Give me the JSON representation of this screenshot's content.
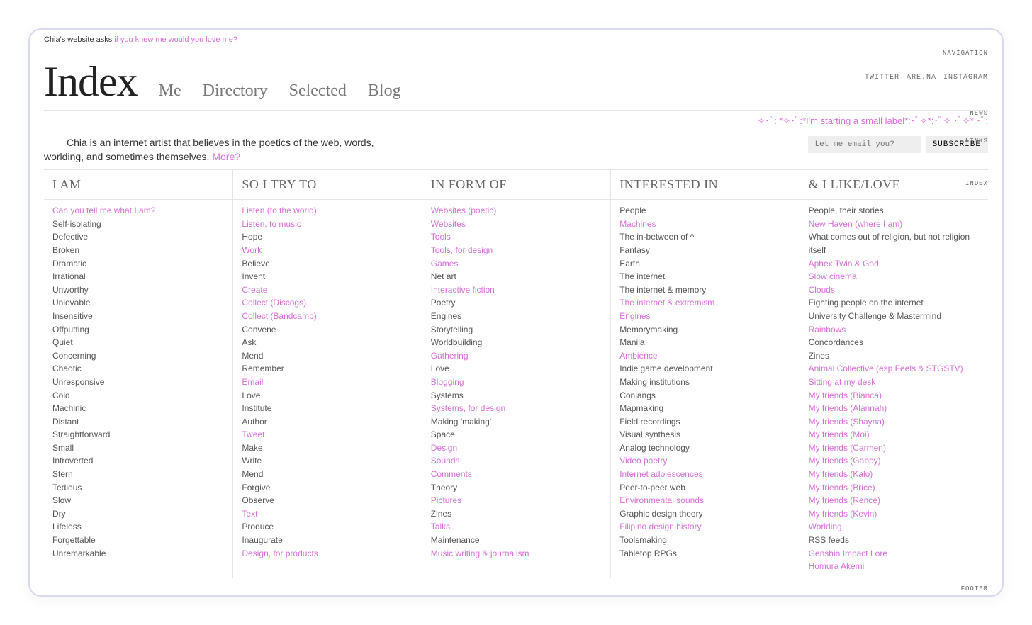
{
  "tagline_prefix": "Chia's website asks ",
  "tagline_question": "if you knew me would you love me?",
  "section_labels": {
    "navigation": "NAVIGATION",
    "news": "NEWS",
    "links": "LINKS",
    "index": "INDEX",
    "footer": "FOOTER"
  },
  "logo": "Index",
  "nav": [
    "Me",
    "Directory",
    "Selected",
    "Blog"
  ],
  "socials": [
    "TWITTER",
    "ARE.NA",
    "INSTAGRAM"
  ],
  "news_line": "✧･ﾟ: *✧･ﾟ:*I'm starting a small label*:･ﾟ✧*:･ﾟ✧ ･ﾟ✧*:･ﾟ:",
  "intro_text": "Chia is an internet artist that believes in the poetics of the web, words, worlding, and sometimes themselves. ",
  "intro_more": "More?",
  "subscribe_placeholder": "Let me email you?",
  "subscribe_button": "SUBSCRIBE",
  "columns": [
    {
      "head": "I AM",
      "items": [
        {
          "t": "Can you tell me what I am?",
          "link": true
        },
        {
          "t": "Self-isolating"
        },
        {
          "t": "Defective"
        },
        {
          "t": "Broken"
        },
        {
          "t": "Dramatic"
        },
        {
          "t": "Irrational"
        },
        {
          "t": "Unworthy"
        },
        {
          "t": "Unlovable"
        },
        {
          "t": "Insensitive"
        },
        {
          "t": "Offputting"
        },
        {
          "t": "Quiet"
        },
        {
          "t": "Concerning"
        },
        {
          "t": "Chaotic"
        },
        {
          "t": "Unresponsive"
        },
        {
          "t": "Cold"
        },
        {
          "t": "Machinic"
        },
        {
          "t": "Distant"
        },
        {
          "t": "Straightforward"
        },
        {
          "t": "Small"
        },
        {
          "t": "Introverted"
        },
        {
          "t": "Stern"
        },
        {
          "t": "Tedious"
        },
        {
          "t": "Slow"
        },
        {
          "t": "Dry"
        },
        {
          "t": "Lifeless"
        },
        {
          "t": "Forgettable"
        },
        {
          "t": "Unremarkable"
        }
      ]
    },
    {
      "head": "SO I TRY TO",
      "items": [
        {
          "t": "Listen (to the world)",
          "link": true
        },
        {
          "t": "Listen, to music",
          "link": true
        },
        {
          "t": "Hope"
        },
        {
          "t": "Work",
          "link": true
        },
        {
          "t": "Believe"
        },
        {
          "t": "Invent"
        },
        {
          "t": "Create",
          "link": true
        },
        {
          "t": "Collect (Discogs)",
          "link": true
        },
        {
          "t": "Collect (Bandcamp)",
          "link": true
        },
        {
          "t": "Convene"
        },
        {
          "t": "Ask"
        },
        {
          "t": "Mend"
        },
        {
          "t": "Remember"
        },
        {
          "t": "Email",
          "link": true
        },
        {
          "t": "Love"
        },
        {
          "t": "Institute"
        },
        {
          "t": "Author"
        },
        {
          "t": "Tweet",
          "link": true
        },
        {
          "t": "Make"
        },
        {
          "t": "Write"
        },
        {
          "t": "Mend"
        },
        {
          "t": "Forgive"
        },
        {
          "t": "Observe"
        },
        {
          "t": "Text",
          "link": true
        },
        {
          "t": "Produce"
        },
        {
          "t": "Inaugurate"
        },
        {
          "t": "Design, for products",
          "link": true
        }
      ]
    },
    {
      "head": "IN FORM OF",
      "items": [
        {
          "t": "Websites (poetic)",
          "link": true
        },
        {
          "t": "Websites",
          "link": true
        },
        {
          "t": "Tools",
          "link": true
        },
        {
          "t": "Tools, for design",
          "link": true
        },
        {
          "t": "Games",
          "link": true
        },
        {
          "t": "Net art"
        },
        {
          "t": "Interactive fiction",
          "link": true
        },
        {
          "t": "Poetry"
        },
        {
          "t": "Engines"
        },
        {
          "t": "Storytelling"
        },
        {
          "t": "Worldbuilding"
        },
        {
          "t": "Gathering",
          "link": true
        },
        {
          "t": "Love"
        },
        {
          "t": "Blogging",
          "link": true
        },
        {
          "t": "Systems"
        },
        {
          "t": "Systems, for design",
          "link": true
        },
        {
          "t": "Making 'making'"
        },
        {
          "t": "Space"
        },
        {
          "t": "Design",
          "link": true
        },
        {
          "t": "Sounds",
          "link": true
        },
        {
          "t": "Comments",
          "link": true
        },
        {
          "t": "Theory"
        },
        {
          "t": "Pictures",
          "link": true
        },
        {
          "t": "Zines"
        },
        {
          "t": "Talks",
          "link": true
        },
        {
          "t": "Maintenance"
        },
        {
          "t": "Music writing & journalism",
          "link": true
        }
      ]
    },
    {
      "head": "INTERESTED IN",
      "items": [
        {
          "t": "People"
        },
        {
          "t": "Machines",
          "link": true
        },
        {
          "t": "The in-between of ^"
        },
        {
          "t": "Fantasy"
        },
        {
          "t": "Earth"
        },
        {
          "t": "The internet"
        },
        {
          "t": "The internet & memory"
        },
        {
          "t": "The internet & extremism",
          "link": true
        },
        {
          "t": "Engines",
          "link": true
        },
        {
          "t": "Memorymaking"
        },
        {
          "t": "Manila"
        },
        {
          "t": "Ambience",
          "link": true
        },
        {
          "t": "Indie game development"
        },
        {
          "t": "Making institutions"
        },
        {
          "t": "Conlangs"
        },
        {
          "t": "Mapmaking"
        },
        {
          "t": "Field recordings"
        },
        {
          "t": "Visual synthesis"
        },
        {
          "t": "Analog technology"
        },
        {
          "t": "Video poetry",
          "link": true
        },
        {
          "t": "Internet adolescences",
          "link": true
        },
        {
          "t": "Peer-to-peer web"
        },
        {
          "t": "Environmental sounds",
          "link": true
        },
        {
          "t": "Graphic design theory"
        },
        {
          "t": "Filipino design history",
          "link": true
        },
        {
          "t": "Toolsmaking"
        },
        {
          "t": "Tabletop RPGs"
        }
      ]
    },
    {
      "head": "& I LIKE/LOVE",
      "items": [
        {
          "t": "People, their stories"
        },
        {
          "t": "New Haven (where I am)",
          "link": true
        },
        {
          "t": "What comes out of religion, but not religion itself"
        },
        {
          "t": "Aphex Twin & God",
          "link": true
        },
        {
          "t": "Slow cinema",
          "link": true
        },
        {
          "t": "Clouds",
          "link": true
        },
        {
          "t": "Fighting people on the internet"
        },
        {
          "t": "University Challenge & Mastermind"
        },
        {
          "t": "Rainbows",
          "link": true
        },
        {
          "t": "Concordances"
        },
        {
          "t": "Zines"
        },
        {
          "t": "Animal Collective (esp Feels & STGSTV)",
          "link": true
        },
        {
          "t": "Sitting at my desk",
          "link": true
        },
        {
          "t": "My friends (Bianca)",
          "link": true
        },
        {
          "t": "My friends (Alannah)",
          "link": true
        },
        {
          "t": "My friends (Shayna)",
          "link": true
        },
        {
          "t": "My friends (Moi)",
          "link": true
        },
        {
          "t": "My friends (Carmen)",
          "link": true
        },
        {
          "t": "My friends (Gabby)",
          "link": true
        },
        {
          "t": "My friends (Kalo)",
          "link": true
        },
        {
          "t": "My friends (Brice)",
          "link": true
        },
        {
          "t": "My friends (Rence)",
          "link": true
        },
        {
          "t": "My friends (Kevin)",
          "link": true
        },
        {
          "t": "Worlding",
          "link": true
        },
        {
          "t": "RSS feeds"
        },
        {
          "t": "Genshin Impact Lore",
          "link": true
        },
        {
          "t": "Homura Akemi",
          "link": true
        }
      ]
    }
  ]
}
